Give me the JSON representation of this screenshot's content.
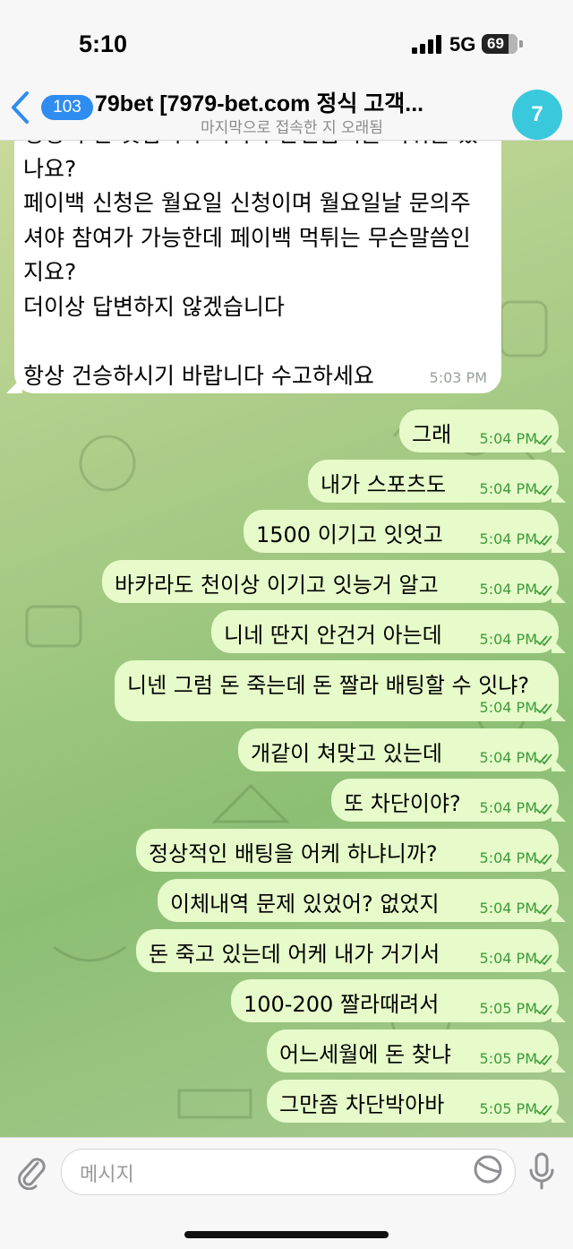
{
  "status_bar": {
    "time": "5:10",
    "network": "5G",
    "battery": "69"
  },
  "header": {
    "back_badge": "103",
    "title": "79bet [7979-bet.com 정식 고객...",
    "subtitle": "마지막으로 접속한 지 오래됨",
    "avatar_label": "7"
  },
  "incoming_message": {
    "text": "성정리 안 것입니나 서희가 완선금액을 먹뒤들 했\n나요?\n페이백 신청은 월요일 신청이며 월요일날 문의주\n셔야 참여가 가능한데 페이백 먹튀는 무슨말씀인\n지요?\n더이상 답변하지 않겠습니다\n\n항상 건승하시기 바랍니다 수고하세요",
    "time": "5:03 PM"
  },
  "outgoing_messages": [
    {
      "text": "그래",
      "time": "5:04 PM"
    },
    {
      "text": "내가 스포츠도",
      "time": "5:04 PM"
    },
    {
      "text": "1500 이기고 잇엇고",
      "time": "5:04 PM"
    },
    {
      "text": "바카라도 천이상 이기고 잇능거 알고",
      "time": "5:04 PM"
    },
    {
      "text": "니네 딴지 안건거 아는데",
      "time": "5:04 PM"
    },
    {
      "text": "니넨 그럼 돈 죽는데 돈 짤라 배팅할 수 잇냐?",
      "time": "5:04 PM"
    },
    {
      "text": "개같이 쳐맞고 있는데",
      "time": "5:04 PM"
    },
    {
      "text": "또 차단이야?",
      "time": "5:04 PM"
    },
    {
      "text": "정상적인 배팅을 어케 하냐니까?",
      "time": "5:04 PM"
    },
    {
      "text": "이체내역 문제 있었어? 없었지",
      "time": "5:04 PM"
    },
    {
      "text": "돈 죽고 있는데 어케 내가 거기서",
      "time": "5:04 PM"
    },
    {
      "text": "100-200 짤라때려서",
      "time": "5:05 PM"
    },
    {
      "text": "어느세월에 돈 찾냐",
      "time": "5:05 PM"
    },
    {
      "text": "그만좀 차단박아바",
      "time": "5:05 PM"
    }
  ],
  "composer": {
    "placeholder": "메시지"
  },
  "icons": [
    "back-chevron-icon",
    "signal-icon",
    "battery-icon",
    "attach-paperclip-icon",
    "sticker-icon",
    "microphone-icon",
    "read-checkmarks-icon"
  ],
  "colors": {
    "outgoing_bubble": "#e6fbc9",
    "time_green": "#3d9b3a",
    "badge_blue": "#2f8cf0",
    "avatar_teal": "#3ac8dc"
  }
}
